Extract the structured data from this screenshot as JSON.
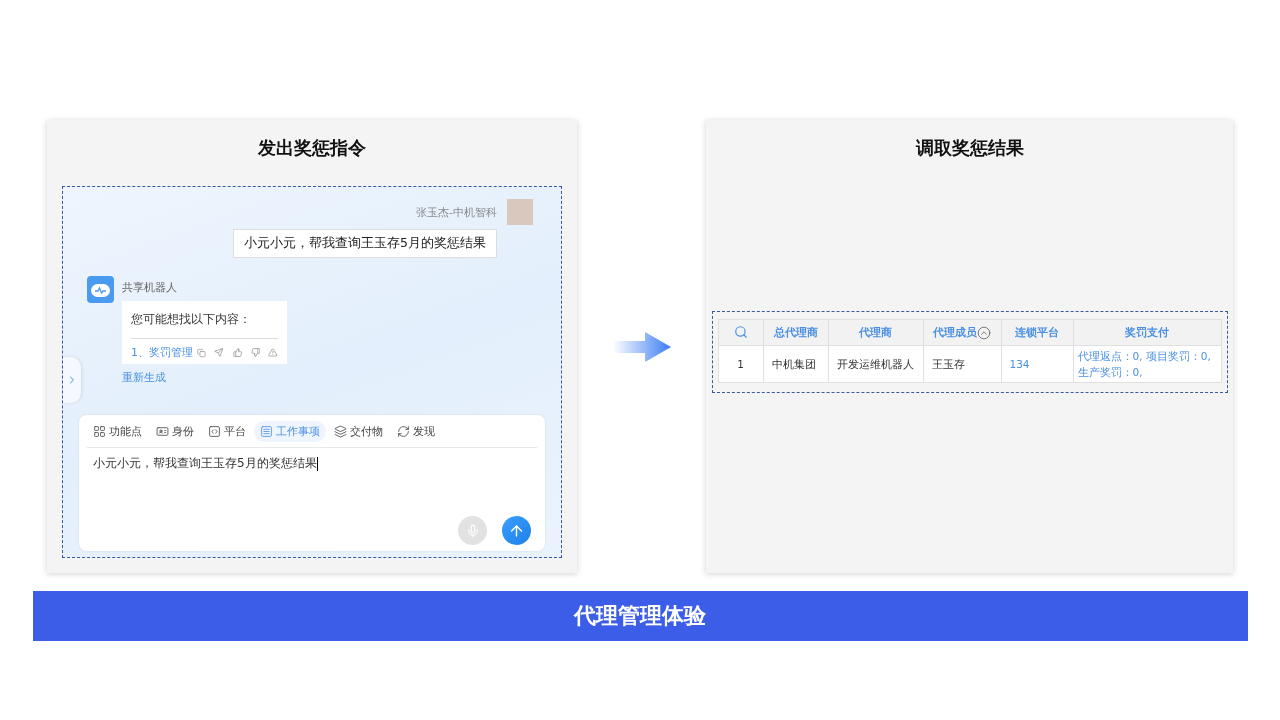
{
  "left_panel": {
    "title": "发出奖惩指令",
    "chat": {
      "user_name": "张玉杰-中机智科",
      "user_message": "小元小元，帮我查询王玉存5月的奖惩结果",
      "bot_name": "共享机器人",
      "bot_intro": "您可能想找以下内容：",
      "bot_link": "1、奖罚管理",
      "regenerate": "重新生成"
    },
    "composer": {
      "tabs": [
        {
          "label": "功能点",
          "kind": "grid",
          "selected": false
        },
        {
          "label": "身份",
          "kind": "card",
          "selected": false
        },
        {
          "label": "平台",
          "kind": "code",
          "selected": false
        },
        {
          "label": "工作事项",
          "kind": "list",
          "selected": true
        },
        {
          "label": "交付物",
          "kind": "layers",
          "selected": false
        },
        {
          "label": "发现",
          "kind": "refresh",
          "selected": false
        }
      ],
      "value": "小元小元，帮我查询王玉存5月的奖惩结果"
    }
  },
  "right_panel": {
    "title": "调取奖惩结果",
    "table": {
      "columns": [
        {
          "label": "总代理商",
          "sortable": false
        },
        {
          "label": "代理商",
          "sortable": false
        },
        {
          "label": "代理成员",
          "sortable": true
        },
        {
          "label": "连锁平台",
          "sortable": false
        },
        {
          "label": "奖罚支付",
          "sortable": false
        }
      ],
      "rows": [
        {
          "index": "1",
          "cells": [
            {
              "text": "中机集团",
              "kind": "plain"
            },
            {
              "text": "开发运维机器人",
              "kind": "plain"
            },
            {
              "text": "王玉存",
              "kind": "plain"
            },
            {
              "text": "134",
              "kind": "link"
            },
            {
              "text": "代理返点：0, 项目奖罚：0, 生产奖罚：0,",
              "kind": "link"
            }
          ]
        }
      ]
    }
  },
  "banner": "代理管理体验"
}
